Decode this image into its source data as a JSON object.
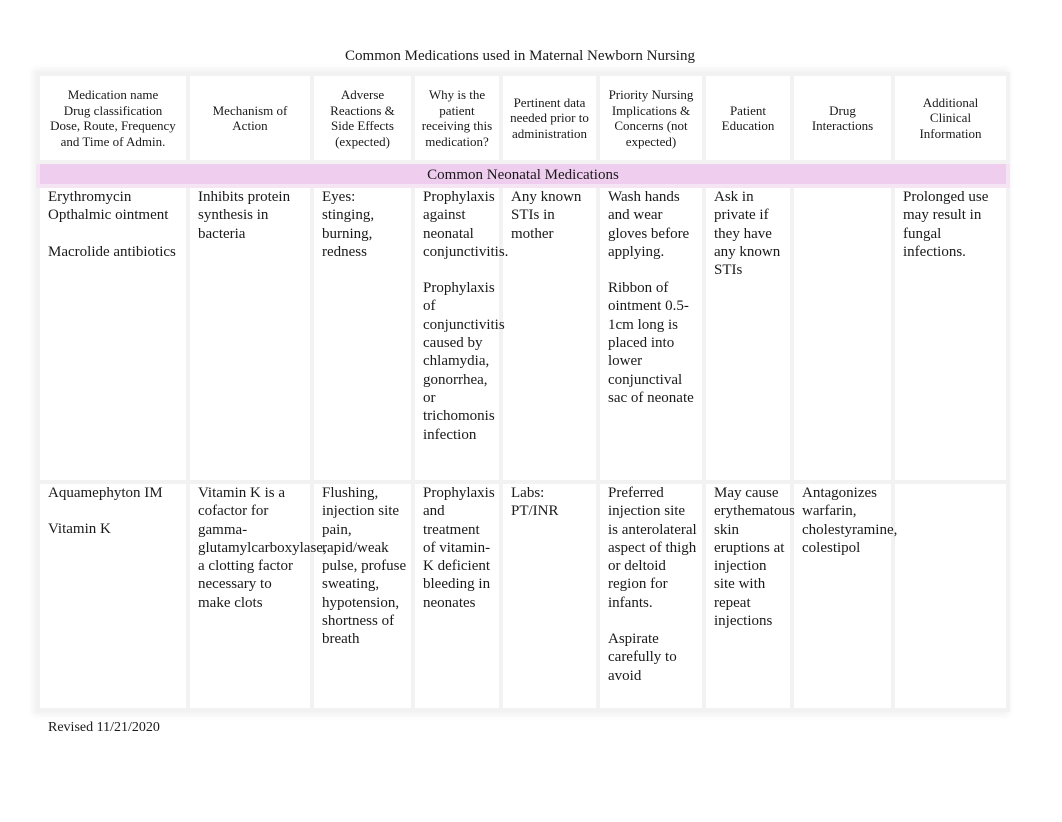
{
  "document": {
    "title": "Common Medications used in Maternal Newborn Nursing",
    "footer": "Revised 11/21/2020"
  },
  "table": {
    "headers": [
      "Medication name Drug classification Dose, Route, Frequency and Time of Admin.",
      "Mechanism of Action",
      "Adverse Reactions & Side Effects (expected)",
      "Why is the patient receiving this medication?",
      "Pertinent data needed prior to administration",
      "Priority Nursing Implications & Concerns (not expected)",
      "Patient Education",
      "Drug Interactions",
      "Additional Clinical Information"
    ],
    "header_lines": [
      [
        "Medication name",
        "Drug classification",
        "Dose, Route, Frequency",
        "and Time of Admin."
      ],
      [
        "Mechanism of",
        "Action"
      ],
      [
        "Adverse",
        "Reactions &",
        "Side Effects",
        "(expected)"
      ],
      [
        "Why is the",
        "patient",
        "receiving this",
        "medication?"
      ],
      [
        "Pertinent data",
        "needed prior to",
        "administration"
      ],
      [
        "Priority Nursing",
        "Implications &",
        "Concerns (not",
        "expected)"
      ],
      [
        "Patient",
        "Education"
      ],
      [
        "Drug",
        "Interactions"
      ],
      [
        "Additional",
        "Clinical",
        "Information"
      ]
    ],
    "section_label": "Common Neonatal Medications",
    "section_color": "#efcdef",
    "rows": [
      {
        "medication": [
          "Erythromycin Opthalmic ointment",
          "Macrolide antibiotics"
        ],
        "mechanism": [
          "Inhibits protein synthesis in bacteria"
        ],
        "adverse_effects": [
          "Eyes: stinging, burning, redness"
        ],
        "indication": [
          "Prophylaxis against neonatal conjunctivitis.",
          "Prophylaxis of conjunctivitis caused by chlamydia, gonorrhea, or trichomonis infection"
        ],
        "pertinent_data": [
          "Any known STIs in mother"
        ],
        "nursing_implications": [
          "Wash hands and wear gloves before applying.",
          "Ribbon of ointment 0.5-1cm long is placed into lower conjunctival sac of neonate"
        ],
        "patient_education": [
          "Ask in private if they have any known STIs"
        ],
        "drug_interactions": [],
        "additional_info": [
          "Prolonged use may result in fungal infections."
        ]
      },
      {
        "medication": [
          "Aquamephyton IM",
          "Vitamin K"
        ],
        "mechanism": [
          "Vitamin K is a cofactor for gamma-glutamylcarboxylase, a clotting factor necessary to make clots"
        ],
        "adverse_effects": [
          "Flushing, injection site pain, rapid/weak pulse, profuse sweating, hypotension, shortness of breath"
        ],
        "indication": [
          "Prophylaxis and treatment of vitamin-K deficient bleeding in neonates"
        ],
        "pertinent_data": [
          "Labs: PT/INR"
        ],
        "nursing_implications": [
          "Preferred injection site is anterolateral aspect of thigh or deltoid region for infants.",
          "Aspirate carefully to avoid"
        ],
        "patient_education": [
          "May cause erythematous skin eruptions at injection site with repeat injections"
        ],
        "drug_interactions": [
          "Antagonizes warfarin, cholestyramine, colestipol"
        ],
        "additional_info": []
      }
    ]
  }
}
